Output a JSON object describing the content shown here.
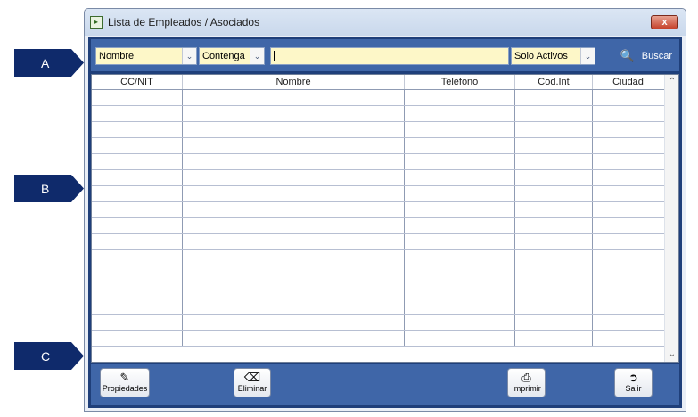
{
  "callouts": {
    "a": "A",
    "b": "B",
    "c": "C"
  },
  "window": {
    "title": "Lista de Empleados / Asociados",
    "close_label": "x"
  },
  "toolbar": {
    "field_select": "Nombre",
    "match_select": "Contenga",
    "search_value": "",
    "status_select": "Solo Activos",
    "search_button": "Buscar"
  },
  "table": {
    "columns": [
      "CC/NIT",
      "Nombre",
      "Teléfono",
      "Cod.Int",
      "Ciudad"
    ],
    "row_count": 16
  },
  "footer": {
    "properties": "Propiedades",
    "delete": "Eliminar",
    "print": "Imprimir",
    "exit": "Salir"
  },
  "icons": {
    "app": "app-icon",
    "search": "magnifier-icon",
    "properties": "edit-document-icon",
    "delete": "eraser-icon",
    "print": "printer-icon",
    "exit": "exit-door-icon"
  }
}
